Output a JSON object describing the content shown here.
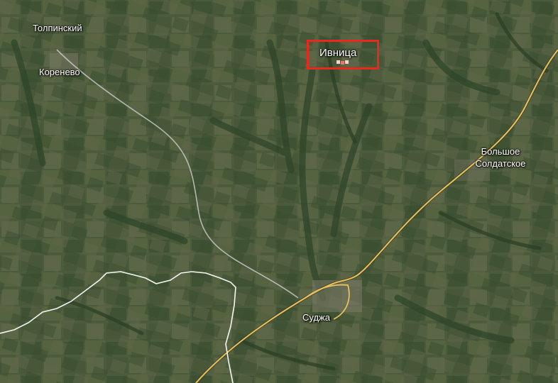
{
  "map": {
    "view": "satellite",
    "places": {
      "tolpinsky": "Толпинский",
      "korenevo": "Коренево",
      "ivnitsa": "Ивница",
      "bolshoe_line1": "Большое",
      "bolshoe_line2": "Солдатское",
      "sudzha": "Суджа"
    },
    "highlight": {
      "target": "Ивница",
      "color": "#e8291c"
    },
    "colors": {
      "highway": "#e8c25a",
      "road": "#c9c9c9",
      "border": "#ffffff",
      "terrain_base": "#4a5a3a"
    }
  }
}
